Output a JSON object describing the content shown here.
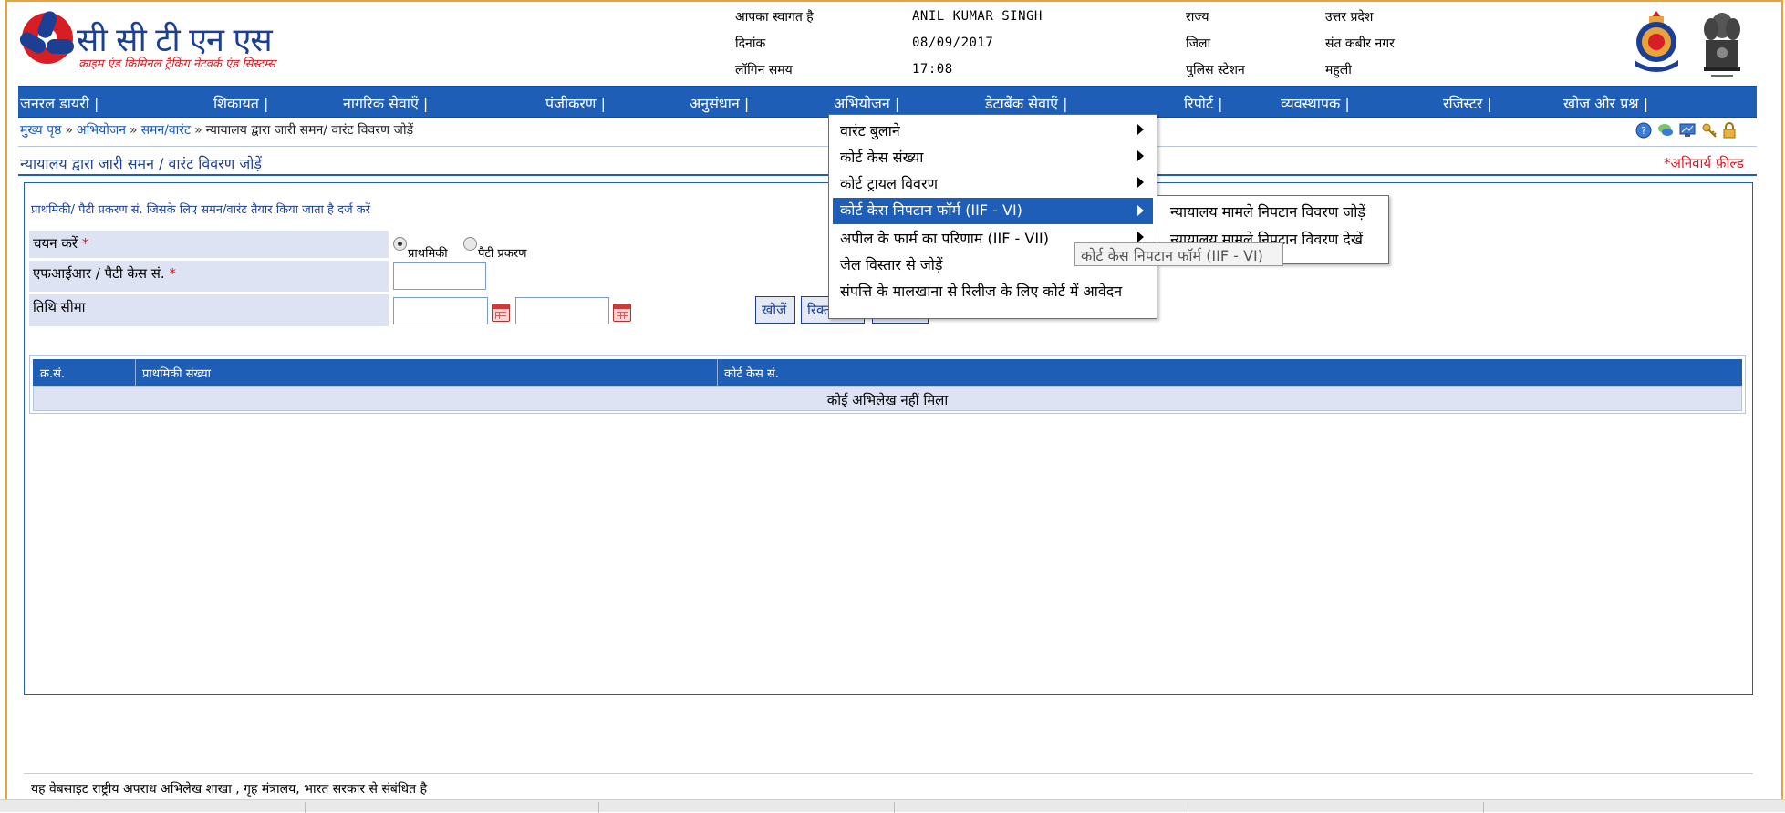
{
  "header": {
    "logo_title": "सी सी टी एन एस",
    "logo_subtitle": "क्राइम एंड क्रिमिनल ट्रैकिंग नेटवर्क एंड सिस्टम्स",
    "welcome_label": "आपका स्वागत है",
    "welcome_value": "ANIL KUMAR SINGH",
    "date_label": "दिनांक",
    "date_value": "08/09/2017",
    "login_time_label": "लॉगिन समय",
    "login_time_value": "17:08",
    "state_label": "राज्य",
    "state_value": "उत्तर प्रदेश",
    "district_label": "जिला",
    "district_value": "संत कबीर नगर",
    "police_station_label": "पुलिस स्टेशन",
    "police_station_value": "महुली"
  },
  "nav": {
    "items": [
      "जनरल डायरी |",
      "शिकायत |",
      "नागरिक सेवाएँ |",
      "पंजीकरण |",
      "अनुसंधान |",
      "अभियोजन |",
      "डेटाबैंक सेवाएँ |",
      "रिपोर्ट |",
      "व्यवस्थापक |",
      "रजिस्टर |",
      "खोज और प्रश्न |"
    ]
  },
  "breadcrumb": {
    "home": "मुख्य पृष्ठ",
    "sep": "»",
    "level1": "अभियोजन",
    "level2": "समन/वारंट",
    "current": "न्यायालय द्वारा जारी समन/ वारंट विवरण जोड़ें"
  },
  "page": {
    "title": "न्यायालय द्वारा जारी समन / वारंट विवरण जोड़ें",
    "mandatory_note": "*अनिवार्य फ़ील्ड"
  },
  "form": {
    "heading": "प्राथमिकी/ पैटी प्रकरण सं. जिसके लिए समन/वारंट तैयार किया जाता है दर्ज करें",
    "select_label": "चयन करें",
    "required_mark": "*",
    "radio_fir": "प्राथमिकी",
    "radio_petty": "पैटी प्रकरण",
    "fir_case_label": "एफआईआर / पैटी केस सं.",
    "date_range_label": "तिथि सीमा",
    "fir_case_value": "",
    "date_from_value": "",
    "date_to_value": "",
    "search_button": "खोजें",
    "reset_button": "रिक्त",
    "close_button": ""
  },
  "table": {
    "columns": [
      "क्र.सं.",
      "प्राथमिकी संख्या",
      "कोर्ट केस सं."
    ],
    "empty_message": "कोई अभिलेख नहीं मिला"
  },
  "menu": {
    "items": [
      {
        "label": "वारंट बुलाने",
        "has_submenu": true
      },
      {
        "label": "कोर्ट केस संख्या",
        "has_submenu": true
      },
      {
        "label": "कोर्ट ट्रायल विवरण",
        "has_submenu": true
      },
      {
        "label": "कोर्ट केस निपटान फॉर्म (IIF - VI)",
        "has_submenu": true,
        "selected": true
      },
      {
        "label": "अपील के फार्म का परिणाम (IIF - VII)",
        "has_submenu": true
      },
      {
        "label": "जेल विस्तार से जोड़ें",
        "has_submenu": false
      },
      {
        "label": "संपत्ति के मालखाना से रिलीज के लिए कोर्ट में आवेदन",
        "has_submenu": false
      }
    ],
    "submenu": [
      "न्यायालय मामले निपटान विवरण जोड़ें",
      "न्यायालय मामले निपटान विवरण देखें"
    ],
    "tooltip": "कोर्ट केस निपटान फॉर्म (IIF - VI)"
  },
  "footer": {
    "text": "यह वेबसाइट राष्ट्रीय अपराध अभिलेख शाखा , गृह मंत्रालय, भारत सरकार से संबंधित है"
  },
  "colors": {
    "nav_blue": "#1f5eb7",
    "header_blue": "#1c3f94",
    "brand_red": "#d81e25",
    "row_bg": "#dde3f3",
    "frame_orange": "#e8a33d"
  }
}
